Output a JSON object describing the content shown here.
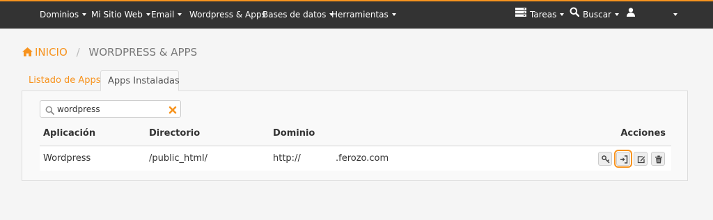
{
  "nav": {
    "items": [
      {
        "label": "Dominios",
        "dropdown": true
      },
      {
        "label": "Mi Sitio Web",
        "dropdown": true
      },
      {
        "label": "Email",
        "dropdown": true
      },
      {
        "label": "Wordpress & Apps",
        "dropdown": false
      },
      {
        "label": "Bases de datos",
        "dropdown": true
      },
      {
        "label": "Herramientas",
        "dropdown": true
      }
    ],
    "right": {
      "tasks_label": "Tareas",
      "tasks_icon": "server-icon",
      "search_label": "Buscar",
      "search_icon": "search-icon",
      "user_icon": "user-icon"
    }
  },
  "breadcrumb": {
    "home": "INICIO",
    "separator": "/",
    "current": "WORDPRESS & APPS"
  },
  "tabs": [
    {
      "label": "Listado de Apps",
      "active": false
    },
    {
      "label": "Apps Instaladas",
      "active": true
    }
  ],
  "search": {
    "value": "wordpress",
    "icon": "search-icon",
    "clear_icon": "clear-x-icon"
  },
  "table": {
    "columns": [
      "Aplicación",
      "Directorio",
      "Dominio",
      "Acciones"
    ],
    "rows": [
      {
        "app": "Wordpress",
        "directory": "/public_html/",
        "domain_prefix": "http://",
        "domain_suffix": ".ferozo.com",
        "actions": [
          "key-icon",
          "sign-in-icon",
          "edit-icon",
          "trash-icon"
        ]
      }
    ]
  },
  "colors": {
    "accent": "#f7931e",
    "topbar": "#333333",
    "background": "#f5f5f5"
  }
}
